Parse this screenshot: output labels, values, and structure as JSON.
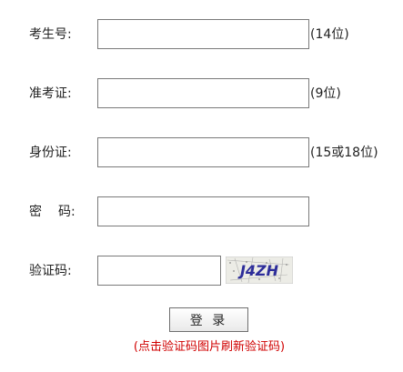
{
  "form": {
    "exam_no": {
      "label": "考生号:",
      "value": "",
      "hint": "(14位)"
    },
    "admit_no": {
      "label": "准考证:",
      "value": "",
      "hint": "(9位)"
    },
    "id_no": {
      "label": "身份证:",
      "value": "",
      "hint": "(15或18位)"
    },
    "password": {
      "label_first": "密",
      "label_second": "码:",
      "value": ""
    },
    "captcha": {
      "label": "验证码:",
      "value": "",
      "image_text": "J4ZH"
    }
  },
  "actions": {
    "login_label": "登 录",
    "captcha_note": "(点击验证码图片刷新验证码)"
  },
  "colors": {
    "note": "#d00000",
    "captcha_text": "#2d2d9a",
    "field_border": "#7a7a7a"
  }
}
